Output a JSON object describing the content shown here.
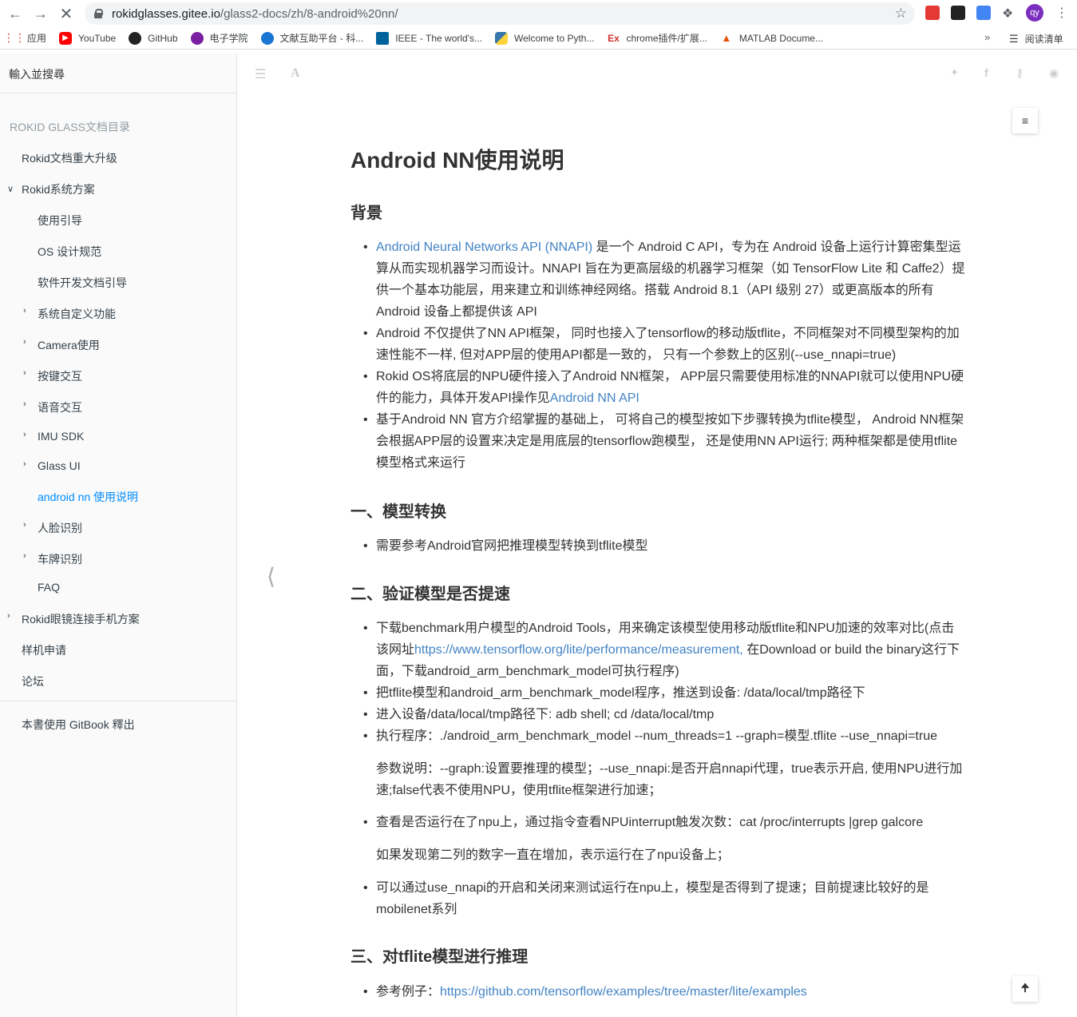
{
  "browser": {
    "url_host": "rokidglasses.gitee.io",
    "url_path": "/glass2-docs/zh/8-android%20nn/",
    "profile_initials": "qy",
    "bookmarks": [
      {
        "label": "应用",
        "icon": "apps-grid-icon"
      },
      {
        "label": "YouTube",
        "icon": "youtube-icon"
      },
      {
        "label": "GitHub",
        "icon": "github-icon"
      },
      {
        "label": "电子学院",
        "icon": "school-icon"
      },
      {
        "label": "文献互助平台 - 科...",
        "icon": "site-icon"
      },
      {
        "label": "IEEE - The world's...",
        "icon": "ieee-icon"
      },
      {
        "label": "Welcome to Pyth...",
        "icon": "python-icon"
      },
      {
        "label": "chrome插件/扩展...",
        "icon": "ex-icon"
      },
      {
        "label": "MATLAB Docume...",
        "icon": "matlab-icon"
      }
    ],
    "reading_list": "阅读清单"
  },
  "sidebar": {
    "search_placeholder": "輸入並搜尋",
    "toc_title": "ROKID GLASS文档目录",
    "items": [
      {
        "label": "Rokid文档重大升级"
      },
      {
        "label": "Rokid系统方案"
      },
      {
        "label": "使用引导"
      },
      {
        "label": "OS 设计规范"
      },
      {
        "label": "软件开发文档引导"
      },
      {
        "label": "系统自定义功能"
      },
      {
        "label": "Camera使用"
      },
      {
        "label": "按键交互"
      },
      {
        "label": "语音交互"
      },
      {
        "label": "IMU SDK"
      },
      {
        "label": "Glass UI"
      },
      {
        "label": "android nn 使用说明"
      },
      {
        "label": "人脸识别"
      },
      {
        "label": "车牌识别"
      },
      {
        "label": "FAQ"
      },
      {
        "label": "Rokid眼镜连接手机方案"
      },
      {
        "label": "样机申请"
      },
      {
        "label": "论坛"
      }
    ],
    "footer": "本書使用 GitBook 釋出"
  },
  "content": {
    "title": "Android NN使用说明",
    "sections": {
      "background": "背景",
      "s1": "一、模型转换",
      "s2": "二、验证模型是否提速",
      "s3": "三、对tflite模型进行推理"
    },
    "bg_items": {
      "b1_link": "Android Neural Networks API (NNAPI)",
      "b1_text": " 是一个 Android C API，专为在 Android 设备上运行计算密集型运算从而实现机器学习而设计。NNAPI 旨在为更高层级的机器学习框架（如 TensorFlow Lite 和 Caffe2）提供一个基本功能层，用来建立和训练神经网络。搭载 Android 8.1（API 级别 27）或更高版本的所有 Android 设备上都提供该 API",
      "b2": "Android 不仅提供了NN API框架， 同时也接入了tensorflow的移动版tflite，不同框架对不同模型架构的加速性能不一样, 但对APP层的使用API都是一致的， 只有一个参数上的区别(--use_nnapi=true)",
      "b3_text": "Rokid OS将底层的NPU硬件接入了Android NN框架， APP层只需要使用标准的NNAPI就可以使用NPU硬件的能力，具体开发API操作见",
      "b3_link": "Android NN API",
      "b4": "基于Android NN 官方介绍掌握的基础上， 可将自己的模型按如下步骤转换为tflite模型， Android NN框架会根据APP层的设置来决定是用底层的tensorflow跑模型， 还是使用NN API运行; 两种框架都是使用tflite模型格式来运行"
    },
    "s1_item": "需要参考Android官网把推理模型转换到tflite模型",
    "s2_items": {
      "i1_pre": "下载benchmark用户模型的Android Tools，用来确定该模型使用移动版tflite和NPU加速的效率对比(点击该网址",
      "i1_link": "https://www.tensorflow.org/lite/performance/measurement,",
      "i1_post": " 在Download or build the binary这行下面，下载android_arm_benchmark_model可执行程序)",
      "i2": "把tflite模型和android_arm_benchmark_model程序，推送到设备: /data/local/tmp路径下",
      "i3": "进入设备/data/local/tmp路径下: adb shell; cd /data/local/tmp",
      "i4": "执行程序：./android_arm_benchmark_model --num_threads=1 --graph=模型.tflite --use_nnapi=true",
      "i4_note": "参数说明：--graph:设置要推理的模型；--use_nnapi:是否开启nnapi代理，true表示开启, 使用NPU进行加速;false代表不使用NPU，使用tflite框架进行加速；",
      "i5": "查看是否运行在了npu上，通过指令查看NPUinterrupt触发次数：cat /proc/interrupts |grep galcore",
      "i5_note": "如果发现第二列的数字一直在增加，表示运行在了npu设备上；",
      "i6": "可以通过use_nnapi的开启和关闭来测试运行在npu上，模型是否得到了提速；目前提速比较好的是mobilenet系列"
    },
    "s3_item_pre": "参考例子：",
    "s3_item_link": "https://github.com/tensorflow/examples/tree/master/lite/examples"
  }
}
